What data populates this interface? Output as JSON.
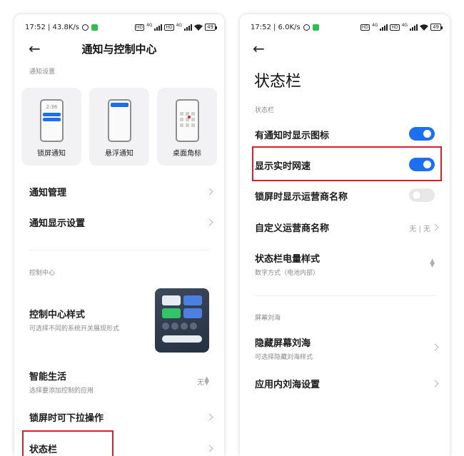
{
  "left": {
    "status": {
      "time": "17:52 | 43.8K/s",
      "battery": "49"
    },
    "title": "通知与控制中心",
    "notif_section": "通知设置",
    "tiles": [
      {
        "label": "锁屏通知",
        "clock": "2:36"
      },
      {
        "label": "悬浮通知"
      },
      {
        "label": "桌面角标"
      }
    ],
    "rows": [
      {
        "main": "通知管理"
      },
      {
        "main": "通知显示设置"
      }
    ],
    "control_section": "控制中心",
    "control_style": {
      "main": "控制中心样式",
      "sub": "可选择不同的系统开关展现形式"
    },
    "smart_life": {
      "main": "智能生活",
      "sub": "选择要添加控制的应用",
      "value": "无"
    },
    "lock_pull": {
      "main": "锁屏时可下拉操作"
    },
    "status_bar": {
      "main": "状态栏"
    }
  },
  "right": {
    "status": {
      "time": "17:52 | 6.0K/s",
      "battery": "49"
    },
    "title": "状态栏",
    "section1": "状态栏",
    "rows": [
      {
        "main": "有通知时显示图标",
        "toggle": true
      },
      {
        "main": "显示实时网速",
        "toggle": true
      },
      {
        "main": "锁屏时显示运营商名称",
        "toggle": false
      }
    ],
    "carrier": {
      "main": "自定义运营商名称",
      "value": "无 | 无"
    },
    "battery_style": {
      "main": "状态栏电量样式",
      "sub": "数字方式（电池内部）"
    },
    "section2": "屏幕刘海",
    "hide_notch": {
      "main": "隐藏屏幕刘海",
      "sub": "可选择隐藏刘海样式"
    },
    "app_notch": {
      "main": "应用内刘海设置"
    }
  },
  "colors": {
    "accent": "#1d6ff2",
    "highlight": "#e01e28"
  }
}
